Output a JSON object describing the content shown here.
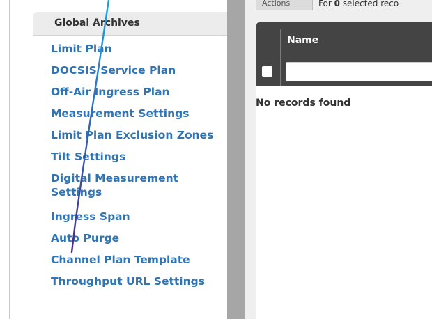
{
  "sidebar": {
    "section_title": "Global Archives",
    "items": [
      {
        "label": "Limit Plan"
      },
      {
        "label": "DOCSIS Service Plan"
      },
      {
        "label": "Off-Air Ingress Plan"
      },
      {
        "label": "Measurement Settings"
      },
      {
        "label": "Limit Plan Exclusion Zones"
      },
      {
        "label": "Tilt Settings"
      },
      {
        "label": "Digital Measurement Settings"
      },
      {
        "label": "Ingress Span"
      },
      {
        "label": "Auto Purge"
      },
      {
        "label": "Channel Plan Template"
      },
      {
        "label": "Throughput URL Settings"
      }
    ]
  },
  "main": {
    "actions_label": "Actions",
    "selected_prefix": "For",
    "selected_count": "0",
    "selected_suffix": "selected reco",
    "grid": {
      "column_name": "Name",
      "filter_value": "",
      "empty_message": "No records found"
    }
  },
  "colors": {
    "link": "#2f74b5",
    "header_bg": "#444444",
    "stroke_start": "#1aa3e0",
    "stroke_end": "#4a2b8c"
  }
}
